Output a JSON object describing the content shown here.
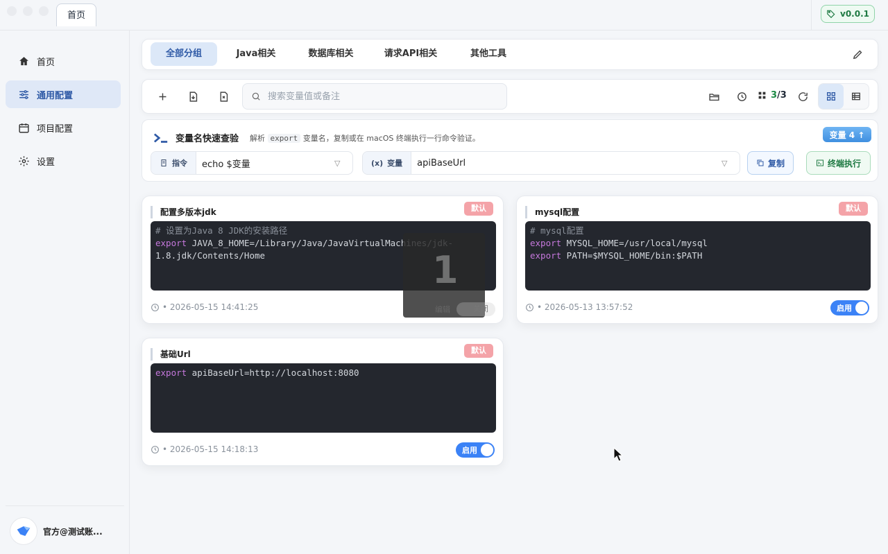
{
  "titlebar": {
    "tab_label": "首页",
    "version": "v0.0.1"
  },
  "sidebar": {
    "items": [
      {
        "label": "首页",
        "icon": "home-icon"
      },
      {
        "label": "通用配置",
        "icon": "sliders-icon"
      },
      {
        "label": "项目配置",
        "icon": "calendar-icon"
      },
      {
        "label": "设置",
        "icon": "gear-icon"
      }
    ],
    "active_index": 1,
    "user_name": "官方@测试账..."
  },
  "groups": {
    "tabs": [
      "全部分组",
      "Java相关",
      "数据库相关",
      "请求API相关",
      "其他工具"
    ],
    "active_index": 0
  },
  "toolbar": {
    "search_placeholder": "搜索变量值或备注",
    "count_current": "3",
    "count_sep": "/3"
  },
  "quick": {
    "title": "变量名快速查验",
    "desc_prefix": "解析",
    "desc_kbd": "export",
    "desc_suffix": "变量名，复制或在 macOS 终端执行一行命令验证。",
    "var_badge": "变量 4 ↑",
    "cmd_label": "指令",
    "cmd_value": "echo $变量",
    "var_label": "变量",
    "var_value": "apiBaseUrl",
    "copy_label": "复制",
    "run_label": "终端执行"
  },
  "cards": [
    {
      "title": "配置多版本jdk",
      "tag": "默认",
      "comment": "# 设置为Java 8 JDK的安装路径",
      "kw": "export",
      "line1": " JAVA_8_HOME=/Library/Java/JavaVirtualMachines/jdk-",
      "line2": "1.8.jdk/Contents/Home",
      "time": "• 2026-05-15 14:41:25"
    },
    {
      "title": "mysql配置",
      "tag": "默认",
      "comment": "# mysql配置",
      "kw": "export",
      "line1": " MYSQL_HOME=/usr/local/mysql",
      "line2": " PATH=$MYSQL_HOME/bin:$PATH",
      "time": "• 2026-05-13 13:57:52",
      "toggle": "启用"
    },
    {
      "title": "基础Url",
      "tag": "默认",
      "kw": "export",
      "line1": " apiBaseUrl=http://localhost:8080",
      "time": "• 2026-05-15 14:18:13",
      "toggle": "启用"
    }
  ],
  "overlay": {
    "number": "1",
    "left_text": "编辑",
    "toggle_text": "关闭"
  }
}
